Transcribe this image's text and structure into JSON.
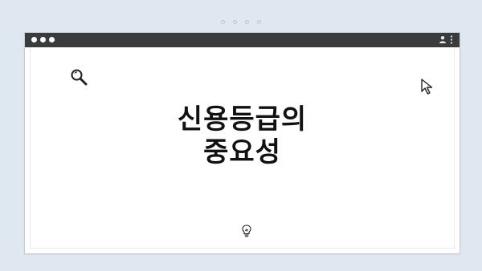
{
  "header": {
    "title_line1": "신용등급의",
    "title_line2": "중요성"
  },
  "icons": {
    "top_dots": "carousel-dots",
    "window_controls": "traffic-light-dots",
    "account": "person-icon",
    "menu": "more-vertical-icon",
    "search": "magnifier-icon",
    "cursor": "arrow-cursor-icon",
    "idea": "lightbulb-icon"
  },
  "colors": {
    "background": "#dfe7f0",
    "titlebar": "#3a3b3d",
    "window": "#ffffff",
    "text": "#111111"
  }
}
